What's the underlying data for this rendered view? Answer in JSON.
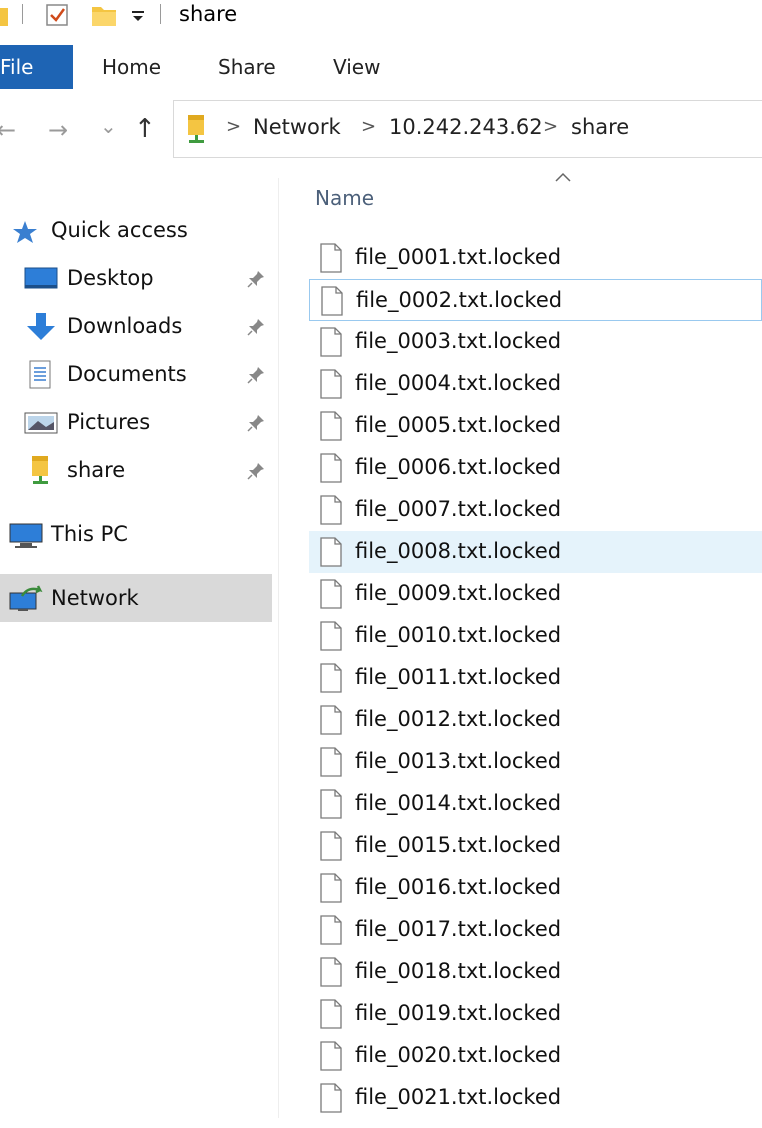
{
  "titlebar": {
    "title": "share"
  },
  "ribbon": {
    "tabs": [
      "File",
      "Home",
      "Share",
      "View"
    ]
  },
  "address": {
    "breadcrumbs": [
      "Network",
      "10.242.243.62",
      "share"
    ],
    "separator": ">"
  },
  "nav": {
    "back": "←",
    "forward": "→",
    "recent": "⌄",
    "up": "↑"
  },
  "sidebar": {
    "quick_access": "Quick access",
    "items": [
      {
        "label": "Desktop",
        "icon": "desktop-icon",
        "pinned": true
      },
      {
        "label": "Downloads",
        "icon": "downloads-icon",
        "pinned": true
      },
      {
        "label": "Documents",
        "icon": "documents-icon",
        "pinned": true
      },
      {
        "label": "Pictures",
        "icon": "pictures-icon",
        "pinned": true
      },
      {
        "label": "share",
        "icon": "folder-icon",
        "pinned": true
      }
    ],
    "this_pc": "This PC",
    "network": "Network"
  },
  "content": {
    "column_name": "Name",
    "files": [
      "file_0001.txt.locked",
      "file_0002.txt.locked",
      "file_0003.txt.locked",
      "file_0004.txt.locked",
      "file_0005.txt.locked",
      "file_0006.txt.locked",
      "file_0007.txt.locked",
      "file_0008.txt.locked",
      "file_0009.txt.locked",
      "file_0010.txt.locked",
      "file_0011.txt.locked",
      "file_0012.txt.locked",
      "file_0013.txt.locked",
      "file_0014.txt.locked",
      "file_0015.txt.locked",
      "file_0016.txt.locked",
      "file_0017.txt.locked",
      "file_0018.txt.locked",
      "file_0019.txt.locked",
      "file_0020.txt.locked",
      "file_0021.txt.locked"
    ],
    "focused_index": 1,
    "hover_index": 7
  },
  "colors": {
    "accent": "#1e64b4",
    "folder": "#f4c542",
    "selected_bg": "#d9d9d9",
    "hover_bg": "#e5f3fb"
  }
}
